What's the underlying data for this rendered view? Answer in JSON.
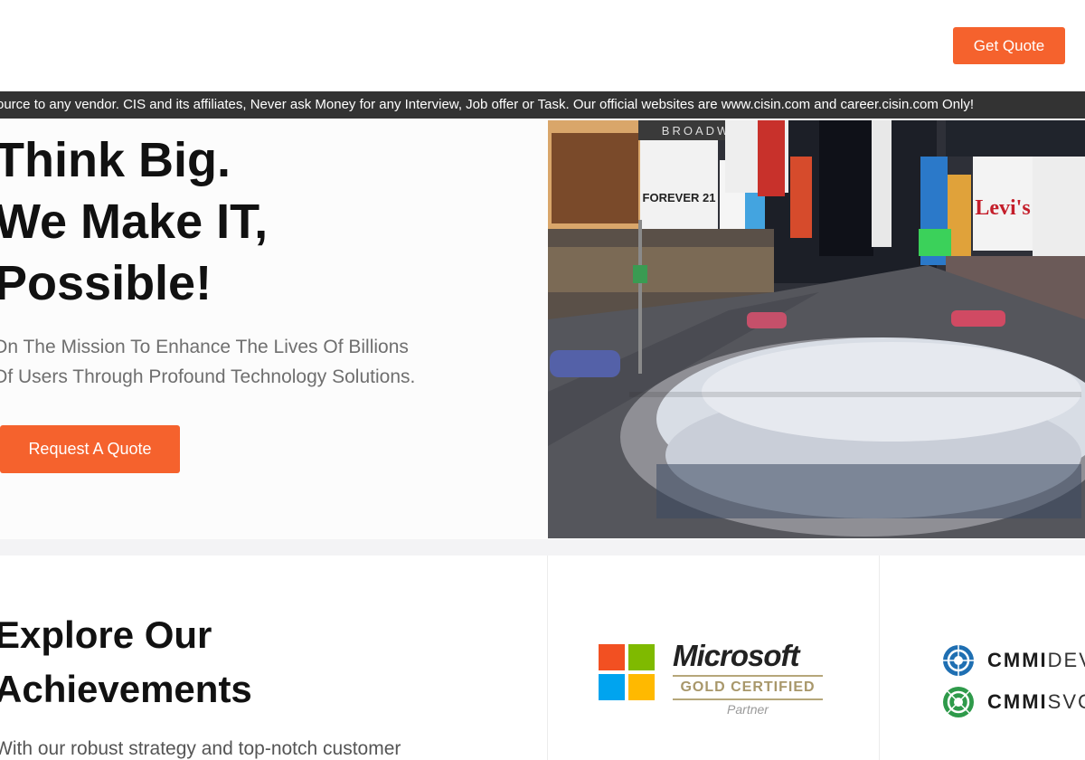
{
  "header": {
    "get_quote_label": "Get Quote"
  },
  "ticker": {
    "text": "ource to any vendor. CIS and its affiliates, Never ask Money for any Interview, Job offer or Task. Our official websites are www.cisin.com and career.cisin.com Only!"
  },
  "hero": {
    "headline_lines": [
      "Think Big.",
      "We Make IT,",
      "Possible!"
    ],
    "mission_lines": [
      "On The Mission To Enhance The Lives Of Billions",
      "Of Users Through Profound Technology Solutions."
    ],
    "request_quote_label": "Request A Quote",
    "photo_signs": {
      "broadway": "BROADWAY",
      "forever21": "FOREVER 21",
      "levis": "Levi's"
    }
  },
  "achievements": {
    "heading_lines": [
      "Explore Our",
      "Achievements"
    ],
    "description": "With our robust strategy and top-notch customer",
    "microsoft": {
      "wordmark": "Microsoft",
      "certification": "GOLD CERTIFIED",
      "tier": "Partner"
    },
    "cmmi": [
      {
        "prefix": "CMMI",
        "suffix": "DEV"
      },
      {
        "prefix": "CMMI",
        "suffix": "SVC"
      }
    ]
  },
  "colors": {
    "accent": "#f5622d",
    "ticker_bg": "#333333",
    "ms_red": "#f25022",
    "ms_green": "#7fba00",
    "ms_blue": "#00a4ef",
    "ms_yellow": "#ffb900",
    "gold": "#b6a77a"
  },
  "icons": [
    "microsoft-logo-icon",
    "cmmi-dev-badge-icon",
    "cmmi-svc-badge-icon"
  ]
}
